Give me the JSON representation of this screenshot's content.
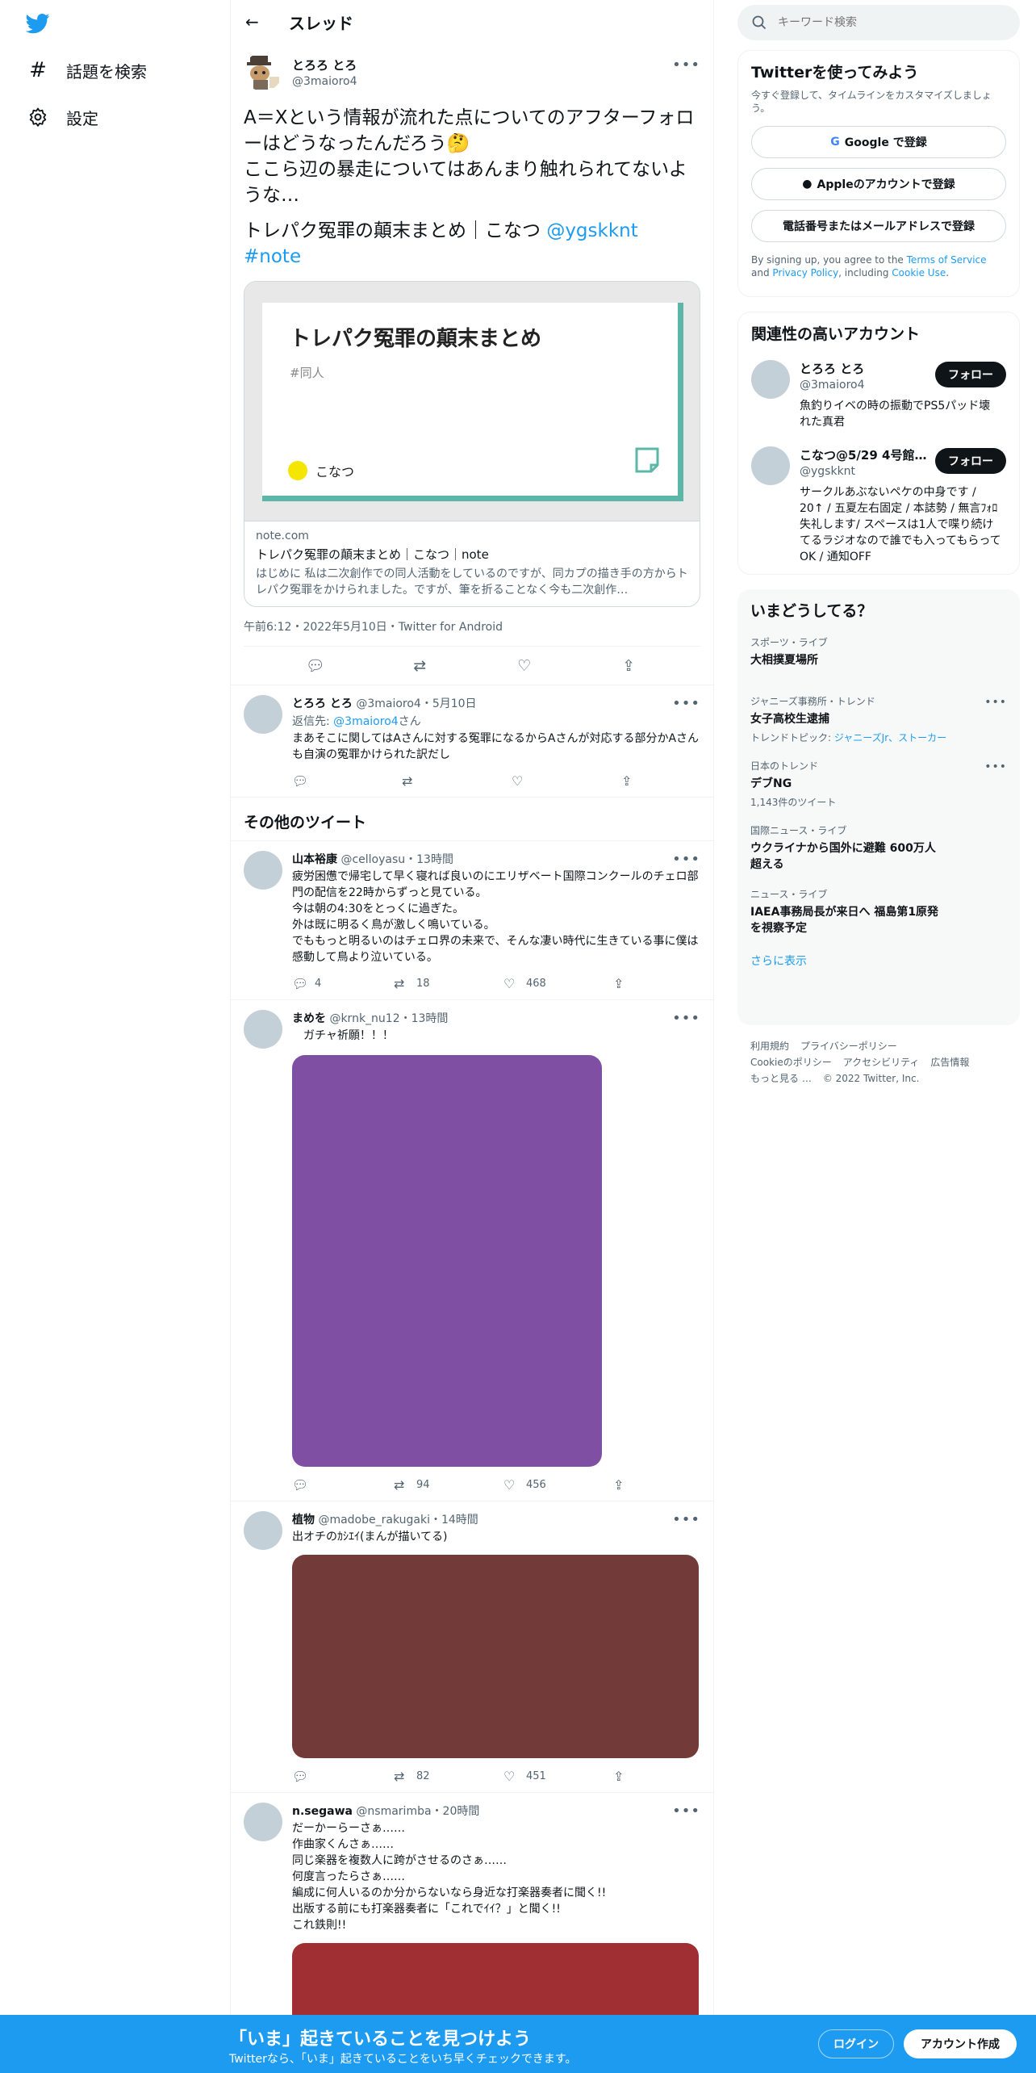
{
  "nav": {
    "explore_label": "話題を検索",
    "settings_label": "設定"
  },
  "header": {
    "title": "スレッド"
  },
  "main_tweet": {
    "name": "とろろ とろ",
    "handle": "@3maioro4",
    "text": "A＝Xという情報が流れた点についてのアフターフォローはどうなったんだろう🤔\nここら辺の暴走についてはあんまり触れられてないような…",
    "text2_prefix": "トレパク冤罪の顛末まとめ｜こなつ ",
    "mention": "@ygskknt",
    "hashtag": "#note",
    "card": {
      "img_title": "トレパク冤罪の顛末まとめ",
      "img_tag": "#同人",
      "img_author": "こなつ",
      "domain": "note.com",
      "title": "トレパク冤罪の顛末まとめ｜こなつ｜note",
      "description": "はじめに 私は二次創作での同人活動をしているのですが、同カプの描き手の方からトレパク冤罪をかけられました。ですが、筆を折ることなく今も二次創作…"
    },
    "timestamp": "午前6:12・2022年5月10日・Twitter for Android"
  },
  "reply": {
    "name": "とろろ とろ",
    "handle_time": "@3maioro4・5月10日",
    "reply_prefix": "返信先: ",
    "reply_to": "@3maioro4",
    "reply_suffix": "さん",
    "text": "まあそこに関してはAさんに対する冤罪になるからAさんが対応する部分かAさんも自演の冤罪かけられた訳だし"
  },
  "more_tweets_title": "その他のツイート",
  "tweets": [
    {
      "name": "山本裕康",
      "handle_time": "@celloyasu・13時間",
      "text": "疲労困憊で帰宅して早く寝れば良いのにエリザベート国際コンクールのチェロ部門の配信を22時からずっと見ている。\n今は朝の4:30をとっくに過ぎた。\n外は既に明るく鳥が激しく鳴いている。\nでももっと明るいのはチェロ界の未来で、そんな凄い時代に生きている事に僕は感動して鳥より泣いている。",
      "replies": "4",
      "retweets": "18",
      "likes": "468"
    },
    {
      "name": "まめを",
      "handle_time": "@krnk_nu12・13時間",
      "text": "　ガチャ祈願！！！",
      "retweets": "94",
      "likes": "456",
      "media_color": "#7f4fa3"
    },
    {
      "name": "植物",
      "handle_time": "@madobe_rakugaki・14時間",
      "text": "出オチのｶｼｴｲ(まんが描いてる)",
      "retweets": "82",
      "likes": "451",
      "media_color": "#733a3a"
    },
    {
      "name": "n.segawa",
      "handle_time": "@nsmarimba・20時間",
      "text": "だーかーらーさぁ……\n作曲家くんさぁ……\n同じ楽器を複数人に跨がさせるのさぁ……\n何度言ったらさぁ……\n編成に何人いるのか分からないなら身近な打楽器奏者に聞く!!\n出版する前にも打楽器奏者に「これでｲｲ？」と聞く!!\nこれ鉄則!!",
      "media_color": "#a02f33"
    }
  ],
  "search": {
    "placeholder": "キーワード検索"
  },
  "signup_panel": {
    "title": "Twitterを使ってみよう",
    "subtitle": "今すぐ登録して、タイムラインをカスタマイズしましょう。",
    "google_btn": "Google で登録",
    "apple_btn": "Appleのアカウントで登録",
    "phone_btn": "電話番号またはメールアドレスで登録",
    "terms_prefix": "By signing up, you agree to the ",
    "terms_link": "Terms of Service",
    "terms_and": " and ",
    "privacy_link": "Privacy Policy",
    "terms_including": ", including ",
    "cookie_link": "Cookie Use",
    "terms_end": "."
  },
  "relevant_panel": {
    "title": "関連性の高いアカウント",
    "accounts": [
      {
        "name": "とろろ とろ",
        "handle": "@3maioro4",
        "bio": "魚釣りイベの時の振動でPS5パッド壊れた真君",
        "follow": "フォロー"
      },
      {
        "name": "こなつ@5/29 4号館L…",
        "handle": "@ygskknt",
        "bio": "サークルあぶないペケの中身です / 20↑ / 五夏左右固定 / 本誌勢 / 無言ﾌｫﾛ失礼します/ スペースは1人で喋り続けてるラジオなので誰でも入ってもらってOK / 通知OFF",
        "follow": "フォロー"
      }
    ]
  },
  "trends_panel": {
    "title": "いまどうしてる？",
    "trends": [
      {
        "context": "スポーツ・ライブ",
        "name": "大相撲夏場所",
        "sub": "",
        "sub_link": ""
      },
      {
        "context": "ジャニーズ事務所・トレンド",
        "name": "女子高校生逮捕",
        "sub": "トレンドトピック: ",
        "sub_link": "ジャニーズJr、ストーカー"
      },
      {
        "context": "日本のトレンド",
        "name": "デブNG",
        "sub": "1,143件のツイート",
        "sub_link": ""
      },
      {
        "context": "国際ニュース・ライブ",
        "name": "ウクライナから国外に避難 600万人超える",
        "sub": "",
        "sub_link": ""
      },
      {
        "context": "ニュース・ライブ",
        "name": "IAEA事務局長が来日へ 福島第1原発を視察予定",
        "sub": "",
        "sub_link": ""
      }
    ],
    "show_more": "さらに表示"
  },
  "footer": {
    "terms": "利用規約",
    "privacy": "プライバシーポリシー",
    "cookie": "Cookieのポリシー",
    "accessibility": "アクセシビリティ",
    "ads": "広告情報",
    "more": "もっと見る …",
    "copyright": "© 2022 Twitter, Inc."
  },
  "bottom_bar": {
    "title": "「いま」起きていることを見つけよう",
    "subtitle": "Twitterなら、「いま」起きていることをいち早くチェックできます。",
    "login": "ログイン",
    "signup": "アカウント作成"
  },
  "colors": {
    "brand": "#1d9bf0",
    "text": "#0f1419",
    "secondary": "#536471"
  }
}
